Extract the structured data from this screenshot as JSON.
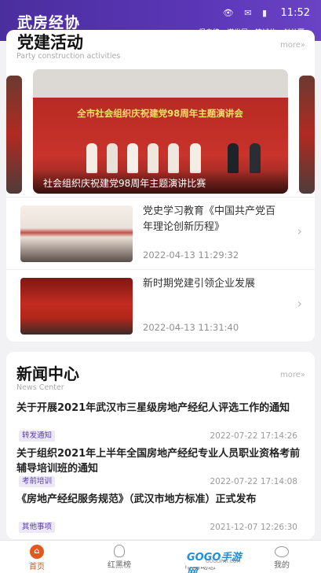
{
  "header": {
    "logo_text": "武房经协",
    "status_icons": "👁 ✉ ▮",
    "time": "11:52",
    "slogan": "促自律、谋发展、铸诚信、创共赢。"
  },
  "party": {
    "title": "党建活动",
    "subtitle": "Party construction activities",
    "more": "more»",
    "carousel": {
      "banner_text": "全市社会组织庆祝建党98周年主题演讲会",
      "caption": "社会组织庆祝建党98周年主题演讲比赛"
    },
    "items": [
      {
        "title": "党史学习教育《中国共产党百年理论创新历程》",
        "date": "2022-04-13 11:29:32"
      },
      {
        "title": "新时期党建引领企业发展",
        "date": "2022-04-13 11:31:40"
      }
    ]
  },
  "news_center": {
    "title": "新闻中心",
    "subtitle": "News Center",
    "more": "more»",
    "items": [
      {
        "title": "关于开展2021年武汉市三星级房地产经纪人评选工作的通知",
        "tag": "转发通知",
        "date": "2022-07-22 17:14:26"
      },
      {
        "title": "关于组织2021年上半年全国房地产经纪专业人员职业资格考前辅导培训班的通知",
        "tag": "考前培训",
        "date": "2022-07-22 17:14:08"
      },
      {
        "title": "《房地产经纪服务规范》（武汉市地方标准）正式发布",
        "tag": "其他事项",
        "date": "2021-12-07 12:26:30"
      }
    ]
  },
  "bottom_nav": {
    "items": [
      {
        "label": "首页",
        "icon": "home-icon",
        "active": true
      },
      {
        "label": "红黑榜",
        "icon": "bulb-icon",
        "active": false
      },
      {
        "label": "市场动态",
        "icon": "market-icon",
        "active": false
      },
      {
        "label": "我的",
        "icon": "profile-icon",
        "active": false
      }
    ]
  },
  "watermark": {
    "text": "GOGO手游网",
    "sub": "GOGOPAT.COM"
  },
  "colors": {
    "header": "#4b2e9e",
    "accent": "#e2591f",
    "tag_bg": "#ece8f6",
    "tag_text": "#5a3fa8"
  }
}
